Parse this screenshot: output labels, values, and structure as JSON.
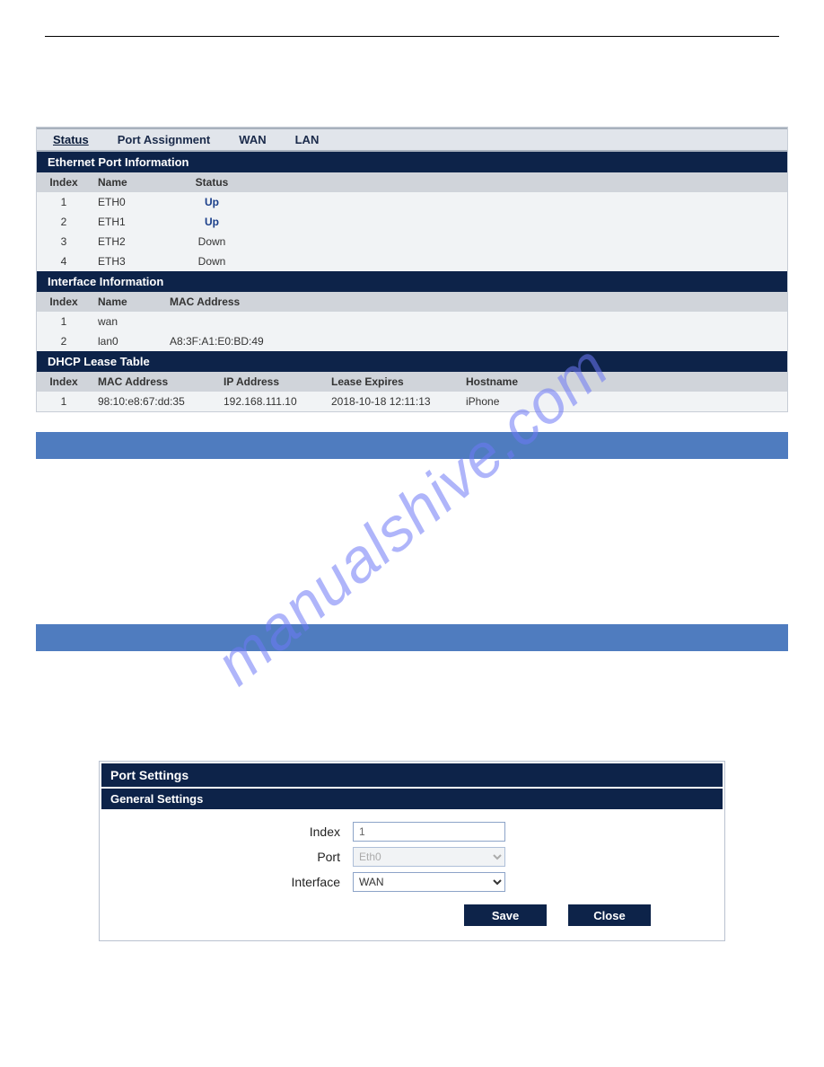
{
  "tabs": {
    "status": "Status",
    "port_assignment": "Port Assignment",
    "wan": "WAN",
    "lan": "LAN"
  },
  "ethernet_port_info": {
    "title": "Ethernet Port Information",
    "headers": {
      "index": "Index",
      "name": "Name",
      "status": "Status"
    },
    "rows": [
      {
        "index": "1",
        "name": "ETH0",
        "status": "Up"
      },
      {
        "index": "2",
        "name": "ETH1",
        "status": "Up"
      },
      {
        "index": "3",
        "name": "ETH2",
        "status": "Down"
      },
      {
        "index": "4",
        "name": "ETH3",
        "status": "Down"
      }
    ]
  },
  "interface_info": {
    "title": "Interface Information",
    "headers": {
      "index": "Index",
      "name": "Name",
      "mac": "MAC Address"
    },
    "rows": [
      {
        "index": "1",
        "name": "wan",
        "mac": ""
      },
      {
        "index": "2",
        "name": "lan0",
        "mac": "A8:3F:A1:E0:BD:49"
      }
    ]
  },
  "dhcp_lease": {
    "title": "DHCP Lease Table",
    "headers": {
      "index": "Index",
      "mac": "MAC Address",
      "ip": "IP Address",
      "expires": "Lease Expires",
      "hostname": "Hostname"
    },
    "rows": [
      {
        "index": "1",
        "mac": "98:10:e8:67:dd:35",
        "ip": "192.168.111.10",
        "expires": "2018-10-18 12:11:13",
        "hostname": "iPhone"
      }
    ]
  },
  "port_settings": {
    "title": "Port Settings",
    "subtitle": "General Settings",
    "labels": {
      "index": "Index",
      "port": "Port",
      "interface": "Interface"
    },
    "values": {
      "index": "1",
      "port": "Eth0",
      "interface": "WAN"
    },
    "buttons": {
      "save": "Save",
      "close": "Close"
    }
  },
  "watermark": "manualshive.com"
}
